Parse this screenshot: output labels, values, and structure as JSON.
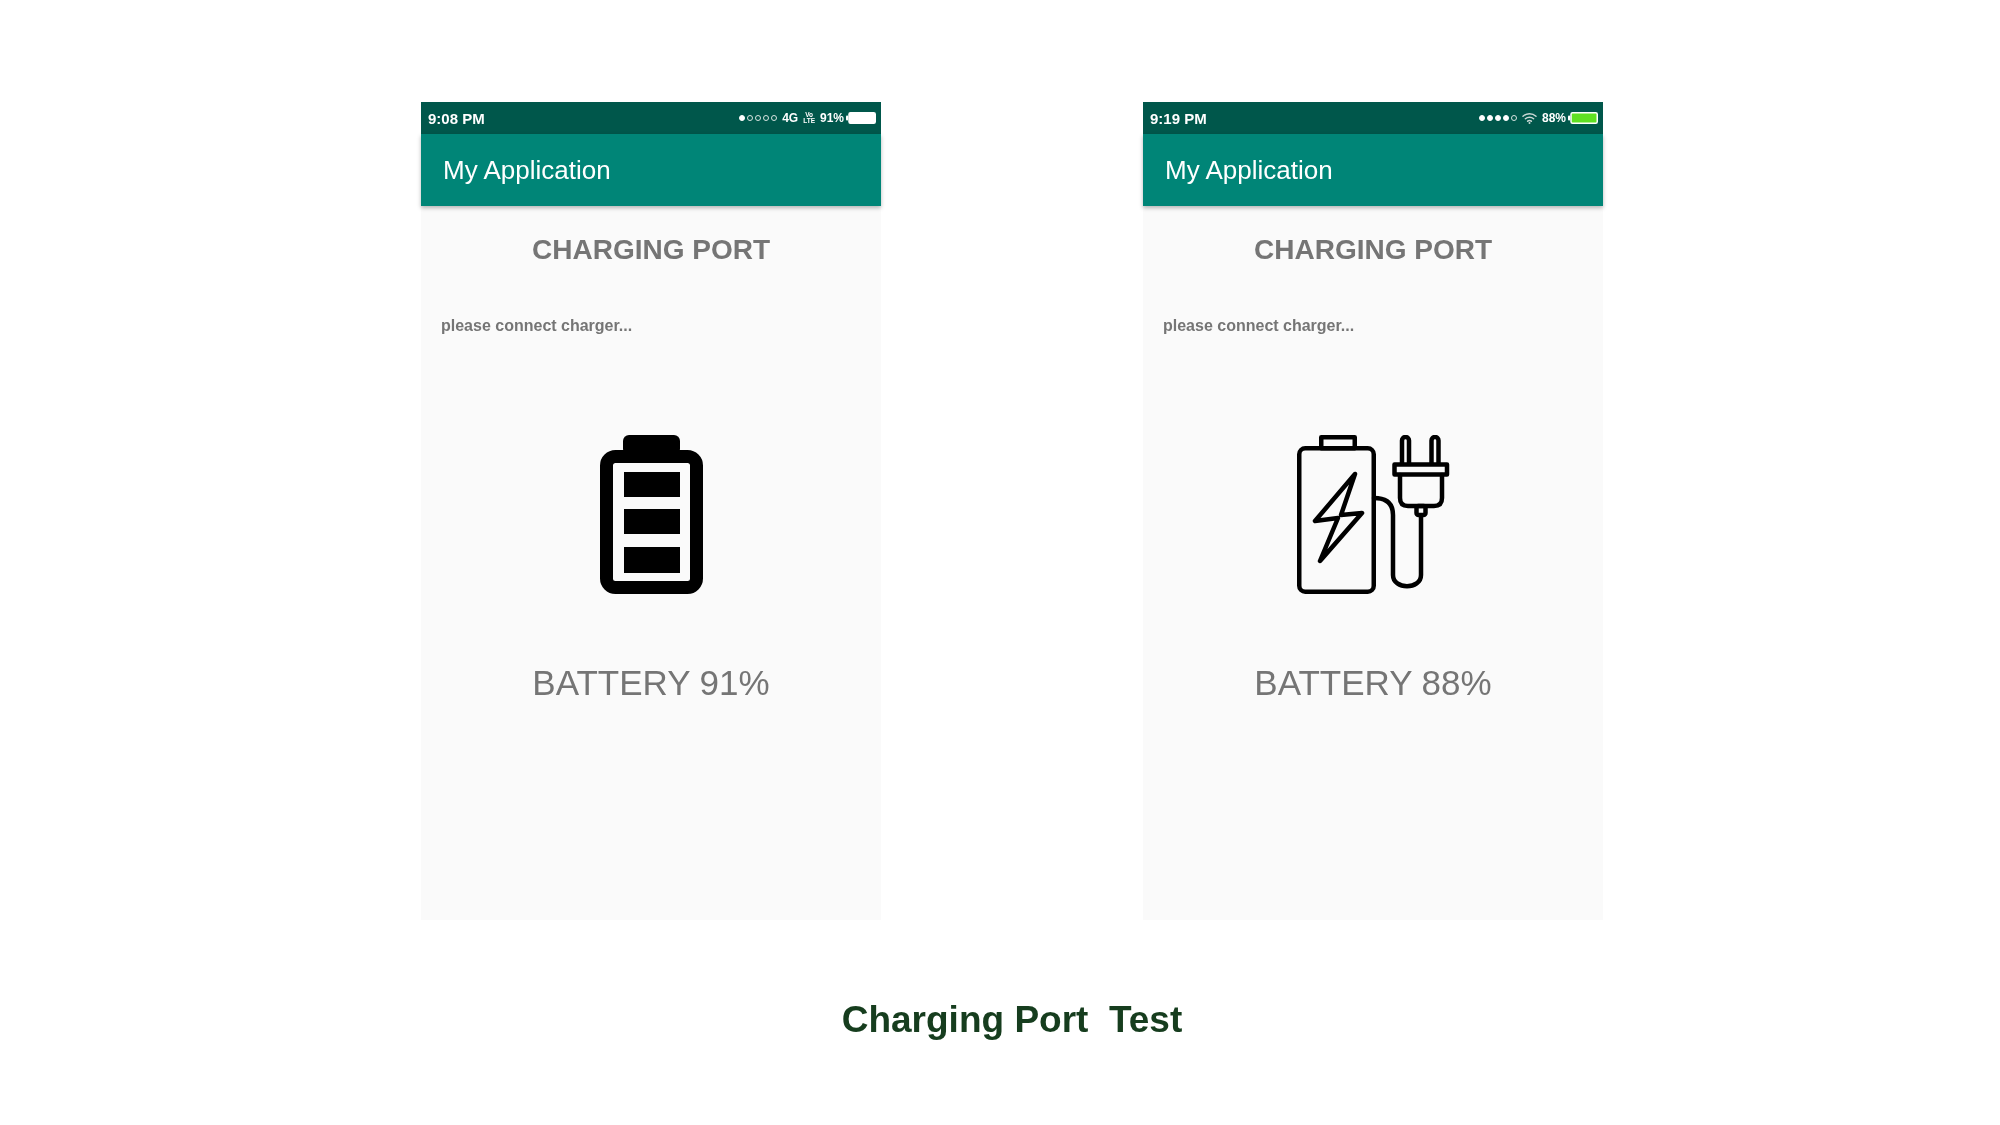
{
  "phones": [
    {
      "status_bar": {
        "time": "9:08 PM",
        "signal": [
          {
            "on": true
          },
          {
            "on": false
          },
          {
            "on": false
          },
          {
            "on": false
          },
          {
            "on": false
          }
        ],
        "indicators": [
          {
            "kind": "text",
            "text": "4G"
          },
          {
            "kind": "stacked",
            "text": "Vo LTE"
          }
        ],
        "battery_percent": "91%",
        "battery_charging": false
      },
      "app_bar": {
        "title": "My Application"
      },
      "heading": "CHARGING PORT",
      "message": "please connect charger...",
      "illustration": {
        "kind": "battery"
      },
      "battery_label": "BATTERY 91%"
    },
    {
      "status_bar": {
        "time": "9:19 PM",
        "signal": [
          {
            "on": true
          },
          {
            "on": true
          },
          {
            "on": true
          },
          {
            "on": true
          },
          {
            "on": false
          }
        ],
        "indicators": [
          {
            "kind": "wifi"
          }
        ],
        "battery_percent": "88%",
        "battery_charging": true
      },
      "app_bar": {
        "title": "My Application"
      },
      "heading": "CHARGING PORT",
      "message": "please connect charger...",
      "illustration": {
        "kind": "charger"
      },
      "battery_label": "BATTERY 88%"
    }
  ],
  "caption": "Charging Port  Test"
}
